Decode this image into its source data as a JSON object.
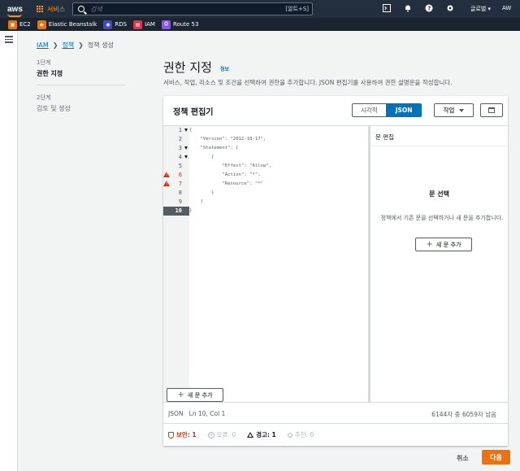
{
  "topnav": {
    "logo": "aws",
    "services": "서비스",
    "search_placeholder": "검색",
    "search_shortcut": "[알트+S]",
    "icons": [
      "terminal-icon",
      "bell-icon",
      "help-icon",
      "gear-icon"
    ],
    "user": "글로벌 ▾",
    "account": "AW"
  },
  "favorites": [
    {
      "label": "EC2",
      "icon": "ec2-icon",
      "color": "#ec7211"
    },
    {
      "label": "Elastic Beanstalk",
      "icon": "beanstalk-icon",
      "color": "#ec7211"
    },
    {
      "label": "RDS",
      "icon": "rds-icon",
      "color": "#3b48cc"
    },
    {
      "label": "IAM",
      "icon": "iam-icon",
      "color": "#dd344c"
    },
    {
      "label": "Route 53",
      "icon": "route53-icon",
      "color": "#8c4fff"
    }
  ],
  "breadcrumb": {
    "items": [
      "IAM",
      "정책"
    ],
    "current": "정책 생성"
  },
  "steps": [
    {
      "num": "1단계",
      "label": "권한 지정"
    },
    {
      "num": "2단계",
      "label": "검토 및 생성"
    }
  ],
  "page": {
    "title": "권한 지정",
    "info": "정보",
    "description": "서비스, 작업, 리소스 및 조건을 선택하여 권한을 추가합니다. JSON 편집기를 사용하여 권한 설명문을 작성합니다."
  },
  "editor": {
    "title": "정책 편집기",
    "tabs": [
      "시각적",
      "JSON"
    ],
    "selected_tab": "JSON",
    "actions": "작업",
    "lines": [
      "{",
      "    \"Version\": \"2012-10-17\",",
      "    \"Statement\": [",
      "        {",
      "            \"Effect\": \"Allow\",",
      "            \"Action\": \"*\",",
      "            \"Resource\": \"*\"",
      "        }",
      "    ]",
      "}"
    ],
    "line_numbers": [
      "1",
      "2",
      "3",
      "4",
      "5",
      "6",
      "7",
      "8",
      "9",
      "10"
    ],
    "add_statement": "새 문 추가"
  },
  "statement_pane": {
    "title": "문 편집",
    "select_title": "문 선택",
    "select_desc": "정책에서 기존 문을 선택하거나 새 문을 추가합니다.",
    "add_statement": "새 문 추가"
  },
  "footer": {
    "status": "JSON   Ln 10, Col 1",
    "chars": "6144자 중 6059자 남음",
    "security": "보안: 1",
    "errors": "오류: 0",
    "warnings": "경고: 1",
    "suggestions": "추천: 0"
  },
  "buttons": {
    "cancel": "취소",
    "next": "다음"
  }
}
